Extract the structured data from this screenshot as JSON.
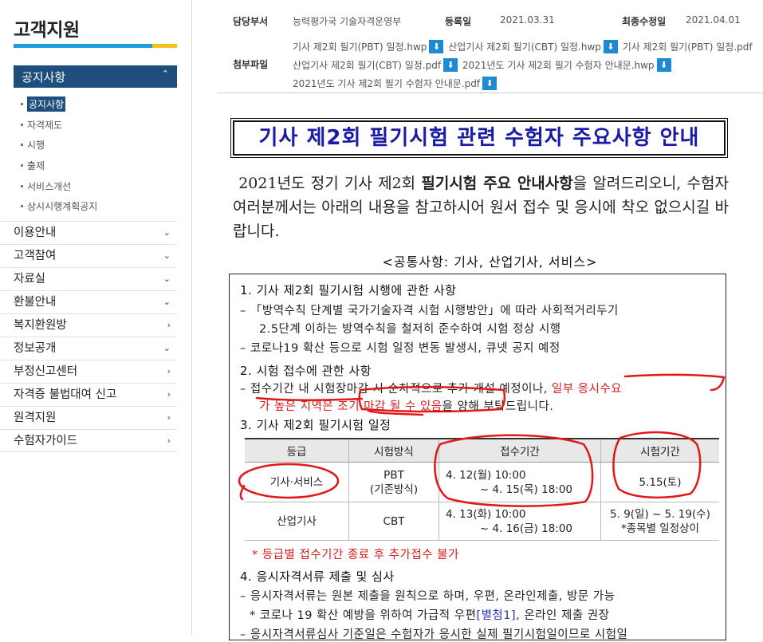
{
  "sidebar": {
    "title": "고객지원",
    "active_section": "공지사항",
    "sub_items": [
      {
        "label": "공지사항",
        "active": true
      },
      {
        "label": "자격제도",
        "active": false
      },
      {
        "label": "시행",
        "active": false
      },
      {
        "label": "출제",
        "active": false
      },
      {
        "label": "서비스개선",
        "active": false
      },
      {
        "label": "상시시행계획공지",
        "active": false
      }
    ],
    "menu": [
      "이용안내",
      "고객참여",
      "자료실",
      "환불안내",
      "복지환원방",
      "정보공개",
      "부정신고센터",
      "자격증 불법대여 신고",
      "원격지원",
      "수험자가이드"
    ],
    "accent": "#1d4e7c"
  },
  "meta": {
    "dept_label": "담당부서",
    "dept_value": "능력평가국 기술자격운영부",
    "reg_label": "등록일",
    "reg_value": "2021.03.31",
    "mod_label": "최종수정일",
    "mod_value": "2021.04.01",
    "attach_label": "첨부파일",
    "attachments": [
      "기사 제2회 필기(PBT) 일정.hwp",
      "산업기사 제2회 필기(CBT) 일정.hwp",
      "기사 제2회 필기(PBT) 일정.pdf",
      "산업기사 제2회 필기(CBT) 일정.pdf",
      "2021년도 기사 제2회 필기 수험자 안내문.hwp",
      "2021년도 기사 제2회 필기 수험자 안내문.pdf"
    ]
  },
  "doc": {
    "title": "기사 제2회 필기시험 관련 수험자 주요사항 안내",
    "intro_1": "2021년도 정기 기사 제2회 ",
    "intro_bold": "필기시험 주요 안내사항",
    "intro_2": "을 알려드리오니, 수험자 여러분께서는 아래의 내용을 참고하시어 원서 접수 및 응시에 착오 없으시길 바랍니다.",
    "common_heading": "<공통사항: 기사, 산업기사, 서비스>",
    "s1_title": "1. 기사 제2회 필기시험 시행에 관한 사항",
    "s1_l1": "– 「방역수칙 단계별 국가기술자격 시험 시행방안」에 따라 사회적거리두기",
    "s1_l2": "2.5단계 이하는 방역수칙을 철저히 준수하여 시험 정상 시행",
    "s1_l3": "– 코로나19 확산 등으로 시험 일정 변동 발생시, 큐넷 공지 예정",
    "s2_title": "2. 시험 접수에 관한 사항",
    "s2_l1a": "– 접수기간 내 시험장마감 시 순차적으로 추가 개설 예정이나, ",
    "s2_l1b": "일부 응시수요",
    "s2_l2a": "가 높은 지역은 ",
    "s2_l2b": "조기 마감 될 수 있음",
    "s2_l2c": "을 양해 부탁드립니다.",
    "s3_title": "3. 기사 제2회 필기시험 일정",
    "table_headers": [
      "등급",
      "시험방식",
      "접수기간",
      "시험기간"
    ],
    "row1": {
      "grade": "기사·서비스",
      "method_1": "PBT",
      "method_2": "(기존방식)",
      "period_1": "4. 12(월) 10:00",
      "period_2": "~ 4. 15(목) 18:00",
      "exam": "5.15(토)"
    },
    "row2": {
      "grade": "산업기사",
      "method": "CBT",
      "period_1": "4. 13(화) 10:00",
      "period_2": "~ 4. 16(금) 18:00",
      "exam_1": "5. 9(일) ~ 5. 19(수)",
      "exam_2": "*종목별 일정상이"
    },
    "note": "* 등급별 접수기간 종료 후 추가접수 불가",
    "s4_title": "4. 응시자격서류 제출 및 심사",
    "s4_l1": "– 응시자격서류는 원본 제출을 원칙으로 하며, 우편, 온라인제출, 방문 가능",
    "s4_l2a": "* 코로나 19 확산 예방을 위하여 가급적 우편",
    "s4_l2b": "[별첨1]",
    "s4_l2c": ", 온라인 제출 권장",
    "s4_l3": "– 응시자격서류심사 기준일은 수험자가 응시한 실제 필기시험일이므로 시험일",
    "annotation_color": "#e01818"
  }
}
